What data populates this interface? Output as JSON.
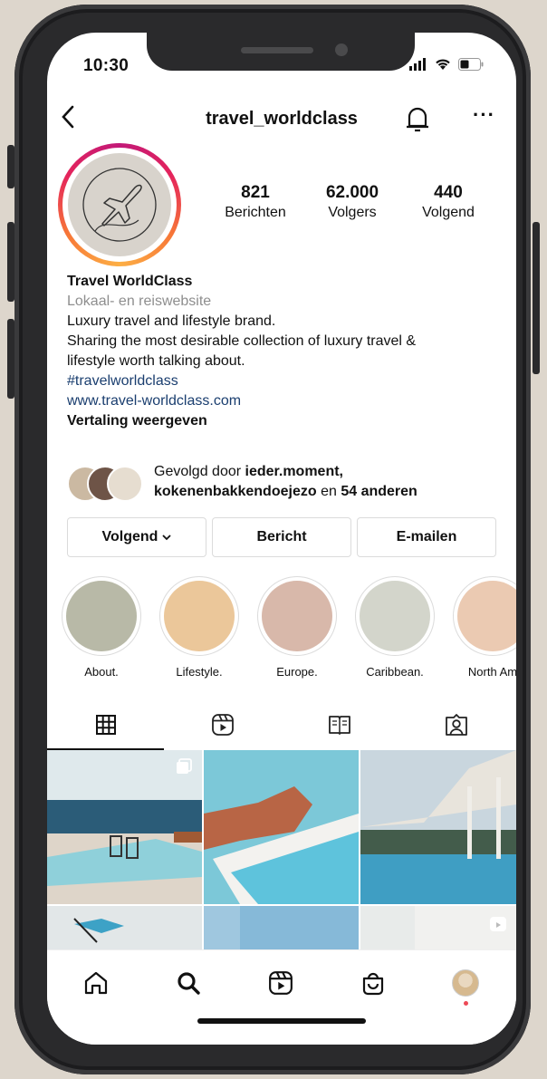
{
  "status": {
    "time": "10:30"
  },
  "header": {
    "username": "travel_worldclass"
  },
  "profile": {
    "stats": [
      {
        "count": "821",
        "label": "Berichten"
      },
      {
        "count": "62.000",
        "label": "Volgers"
      },
      {
        "count": "440",
        "label": "Volgend"
      }
    ],
    "name": "Travel WorldClass",
    "category": "Lokaal- en reiswebsite",
    "bio_line1": "Luxury travel and lifestyle brand.",
    "bio_line2": "Sharing the most desirable collection of luxury travel &",
    "bio_line3": "lifestyle worth talking about.",
    "hashtag": "#travelworldclass",
    "website": "www.travel-worldclass.com",
    "translate": "Vertaling weergeven",
    "followed_by_prefix": "Gevolgd door",
    "followed_by_user1": "ieder.moment,",
    "followed_by_user2": "kokenenbakkendoejezo",
    "followed_by_and": "en",
    "followed_by_rest": "54 anderen"
  },
  "actions": {
    "following": "Volgend",
    "message": "Bericht",
    "email": "E-mailen"
  },
  "highlights": [
    {
      "label": "About.",
      "color": "#b8b9a7"
    },
    {
      "label": "Lifestyle.",
      "color": "#ebc79a"
    },
    {
      "label": "Europe.",
      "color": "#d8b8aa"
    },
    {
      "label": "Caribbean.",
      "color": "#d3d5cb"
    },
    {
      "label": "North Am",
      "color": "#ebcab2"
    }
  ],
  "colors": {
    "story_ring_start": "#c21978",
    "story_ring_end": "#fcaf45",
    "link": "#1a3e6f",
    "notification_dot": "#ed4956"
  }
}
